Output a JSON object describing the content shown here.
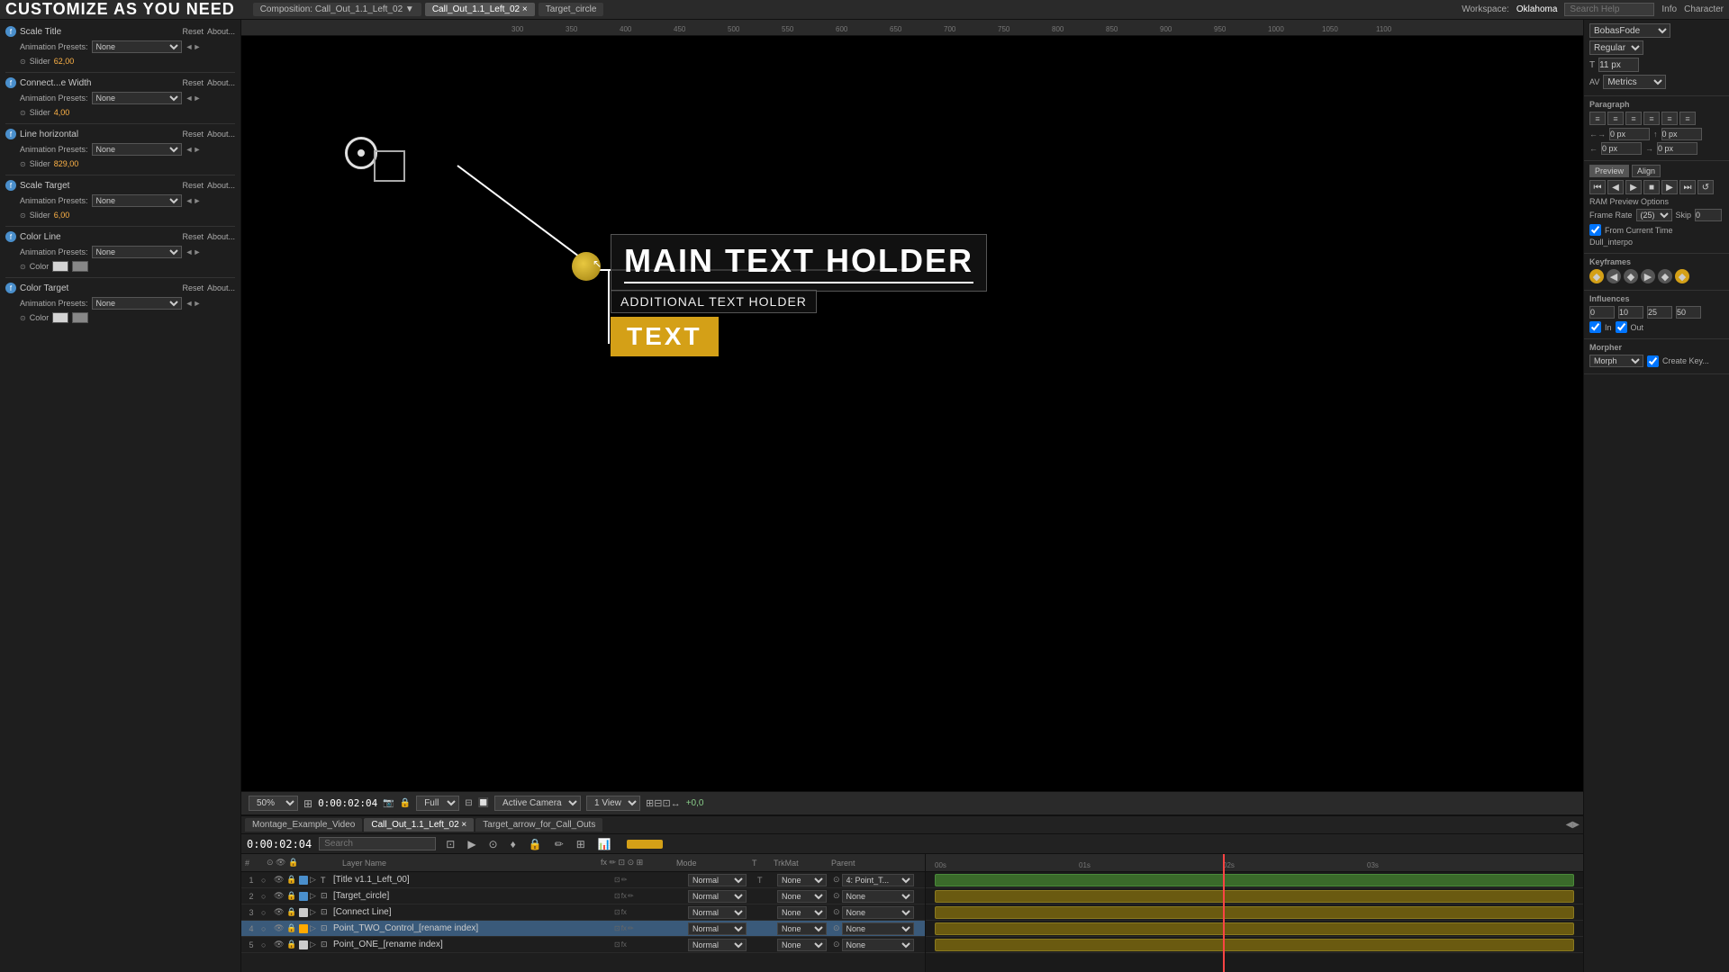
{
  "topbar": {
    "title": "CUSTOMIZE AS YOU NEED",
    "workspace_label": "Workspace:",
    "workspace_value": "Oklahoma",
    "search_placeholder": "Search Help",
    "tabs": [
      {
        "label": "Composition: Call_Out_1.1_Left_02",
        "active": false
      },
      {
        "label": "Call_Out_1.1_Left_02",
        "active": true
      },
      {
        "label": "Target_circle",
        "active": false
      }
    ]
  },
  "left_panel": {
    "title_label": "Scale Title",
    "props": [
      {
        "name": "Scale Title",
        "reset": "Reset",
        "about": "About...",
        "presets_label": "Animation Presets:",
        "presets_value": "None",
        "slider_label": "Slider",
        "slider_value": "62,00"
      },
      {
        "name": "Connect...e Width",
        "reset": "Reset",
        "about": "About...",
        "presets_label": "Animation Presets:",
        "presets_value": "None",
        "slider_label": "Slider",
        "slider_value": "4,00"
      },
      {
        "name": "Line horizontal",
        "reset": "Reset",
        "about": "About...",
        "presets_label": "Animation Presets:",
        "presets_value": "None",
        "slider_label": "Slider",
        "slider_value": "829,00"
      },
      {
        "name": "Scale Target",
        "reset": "Reset",
        "about": "About...",
        "presets_label": "Animation Presets:",
        "presets_value": "None",
        "slider_label": "Slider",
        "slider_value": "6,00"
      },
      {
        "name": "Color Line",
        "reset": "Reset",
        "about": "About...",
        "presets_label": "Animation Presets:",
        "presets_value": "None",
        "color_label": "Color"
      },
      {
        "name": "Color Target",
        "reset": "Reset",
        "about": "About...",
        "presets_label": "Animation Presets:",
        "presets_value": "None",
        "color_label": "Color"
      }
    ]
  },
  "viewport": {
    "main_text": "MAIN TEXT HOLDER",
    "additional_text": "ADDITIONAL TEXT HOLDER",
    "badge_text": "TEXT",
    "zoom": "50%",
    "time_code": "0:00:02:04",
    "quality": "Full",
    "camera": "Active Camera",
    "view": "1 View",
    "coord": "+0,0"
  },
  "timeline": {
    "time_display": "0:00:02:04",
    "search_placeholder": "Search",
    "tabs": [
      {
        "label": "Montage_Example_Video",
        "active": false
      },
      {
        "label": "Call_Out_1.1_Left_02",
        "active": true
      },
      {
        "label": "Target_arrow_for_Call_Outs",
        "active": false
      }
    ],
    "layers": [
      {
        "num": "1",
        "color": "#4a8fcc",
        "name": "[Title v1.1_Left_00]",
        "mode": "Normal",
        "trimat": "None",
        "parent": "4: Point_T..."
      },
      {
        "num": "2",
        "color": "#4a8fcc",
        "name": "[Target_circle]",
        "mode": "Normal",
        "trimat": "None",
        "parent": "None"
      },
      {
        "num": "3",
        "color": "#cccccc",
        "name": "[Connect Line]",
        "mode": "Normal",
        "trimat": "None",
        "parent": "None"
      },
      {
        "num": "4",
        "color": "#ffaa00",
        "name": "Point_TWO_Control_[rename index]",
        "mode": "Normal",
        "trimat": "None",
        "parent": "None",
        "selected": true
      },
      {
        "num": "5",
        "color": "#cccccc",
        "name": "Point_ONE_[rename index]",
        "mode": "Normal",
        "trimat": "None",
        "parent": "None"
      }
    ],
    "ruler_marks": [
      "00s",
      "01s",
      "02s",
      "03s"
    ]
  },
  "right_panel": {
    "font_name": "BobasFode",
    "font_style": "Regular",
    "size_label": "T",
    "size_value": "11 px",
    "kern_label": "AV",
    "kern_value": "Metrics",
    "paragraph_label": "Paragraph",
    "spacing_values": [
      "0 px",
      "0 px",
      "0 px",
      "0 px"
    ],
    "preview_label": "Preview",
    "align_label": "Align",
    "frame_rate_label": "Frame Rate",
    "frame_rate_value": "(25)",
    "skip_value": "0",
    "from_current_label": "From Current Time",
    "ram_preview_label": "RAM Preview Options",
    "interp_label": "Dull_interpo",
    "keyframes_label": "Keyframes",
    "influences_label": "Influences",
    "inf_values": [
      "0",
      "10",
      "25",
      "50"
    ],
    "in_label": "In",
    "out_label": "Out",
    "morpher_label": "Morpher",
    "morph_label": "Morph",
    "create_key_label": "Create Key..."
  }
}
